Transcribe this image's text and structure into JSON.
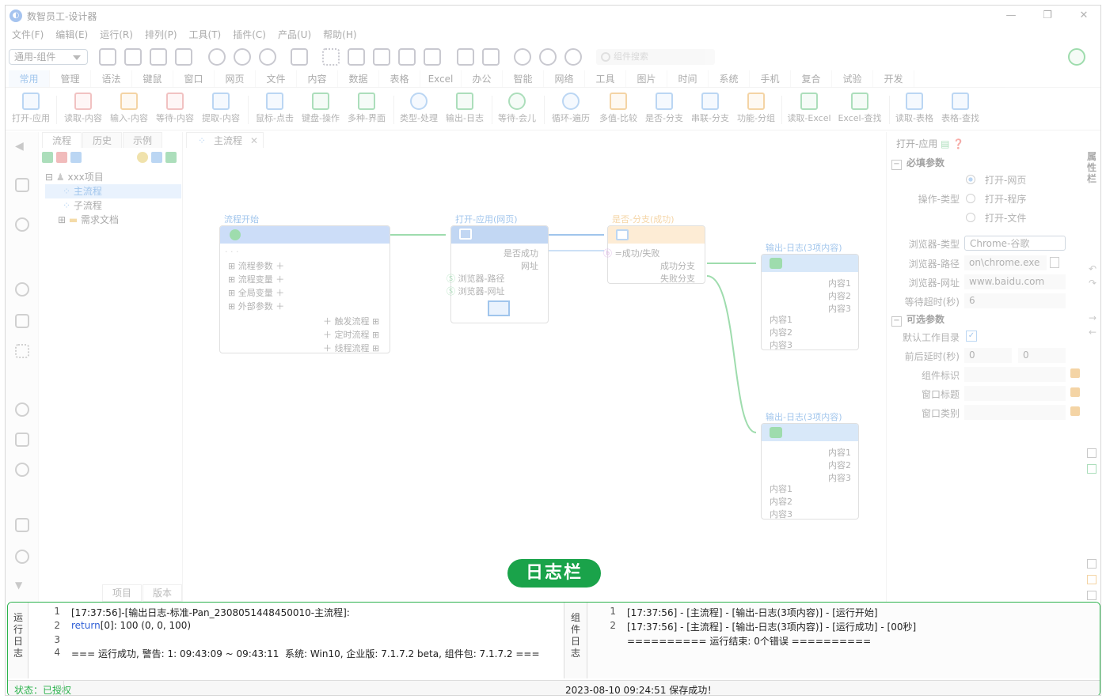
{
  "window": {
    "title": "数智员工-设计器",
    "minimize": "—",
    "maximize": "❐",
    "close": "✕"
  },
  "menu": [
    "文件(F)",
    "编辑(E)",
    "运行(R)",
    "排列(P)",
    "工具(T)",
    "插件(C)",
    "产品(U)",
    "帮助(H)"
  ],
  "toolbar": {
    "combo_value": "通用-组件",
    "search_placeholder": "组件搜索"
  },
  "category_tabs": [
    "常用",
    "管理",
    "语法",
    "键鼠",
    "窗口",
    "网页",
    "文件",
    "内容",
    "数据",
    "表格",
    "Excel",
    "办公",
    "智能",
    "网络",
    "工具",
    "图片",
    "时间",
    "系统",
    "手机",
    "复合",
    "试验",
    "开发"
  ],
  "ribbon": [
    "打开-应用",
    "读取-内容",
    "输入-内容",
    "等待-内容",
    "提取-内容",
    "鼠标-点击",
    "键盘-操作",
    "多种-界面",
    "类型-处理",
    "输出-日志",
    "等待-会儿",
    "循环-遍历",
    "多值-比较",
    "是否-分支",
    "串联-分支",
    "功能-分组",
    "读取-Excel",
    "Excel-查找",
    "读取-表格",
    "表格-查找"
  ],
  "left_panel": {
    "tabs": [
      "流程",
      "历史",
      "示例"
    ],
    "tree": {
      "root": "xxx项目",
      "items": [
        "主流程",
        "子流程",
        "需求文档"
      ]
    },
    "bottom_tabs": [
      "项目",
      "版本"
    ]
  },
  "canvas": {
    "doc_tab": "主流程",
    "doc_tab_close": "✕",
    "nodes": {
      "start": {
        "title": "流程开始",
        "rows": [
          "流程参数",
          "流程变量",
          "全局变量",
          "外部参数"
        ],
        "sub": [
          "触发流程",
          "定时流程",
          "线程流程"
        ],
        "dots": "· · ·"
      },
      "open_app": {
        "title": "打开-应用(网页)",
        "rows": [
          "是否成功",
          "网址"
        ],
        "inputs": [
          "浏览器-路径",
          "浏览器-网址"
        ]
      },
      "branch": {
        "title": "是否-分支(成功)",
        "cond": "=成功/失败",
        "outs": [
          "成功分支",
          "失败分支"
        ]
      },
      "log1": {
        "title": "输出-日志(3项内容)",
        "outs": [
          "内容1",
          "内容2",
          "内容3"
        ],
        "ins": [
          "内容1",
          "内容2",
          "内容3"
        ]
      },
      "log2": {
        "title": "输出-日志(3项内容)",
        "outs": [
          "内容1",
          "内容2",
          "内容3"
        ],
        "ins": [
          "内容1",
          "内容2",
          "内容3"
        ]
      }
    }
  },
  "right_panel": {
    "header": "打开-应用",
    "required": "必填参数",
    "op_type_label": "操作-类型",
    "op_options": [
      "打开-网页",
      "打开-程序",
      "打开-文件"
    ],
    "browser_type_label": "浏览器-类型",
    "browser_type_value": "Chrome-谷歌",
    "browser_path_label": "浏览器-路径",
    "browser_path_value": "on\\chrome.exe",
    "browser_url_label": "浏览器-网址",
    "browser_url_value": "www.baidu.com",
    "timeout_label": "等待超时(秒)",
    "timeout_value": "6",
    "optional": "可选参数",
    "default_dir_label": "默认工作目录",
    "delay_label": "前后延时(秒)",
    "delay_before": "0",
    "delay_after": "0",
    "comp_id_label": "组件标识",
    "win_title_label": "窗口标题",
    "win_class_label": "窗口类别",
    "side_text": "属性栏"
  },
  "overlay_label": "日志栏",
  "log": {
    "run_log_label": "运行日志",
    "comp_log_label": "组件日志",
    "left_lines": [
      {
        "n": "1",
        "t": "[17:37:56]-[输出日志-标准-Pan_2308051448450010-主流程]:"
      },
      {
        "n": "2",
        "kw": "return",
        "t": "[0]: 100 (0, 0, 100)"
      },
      {
        "n": "3",
        "t": ""
      },
      {
        "n": "4",
        "t": "=== 运行成功, 警告: 1: 09:43:09 ~ 09:43:11  系统: Win10, 企业版: 7.1.7.2 beta, 组件包: 7.1.7.2 ==="
      }
    ],
    "right_lines": [
      {
        "n": "1",
        "t": "[17:37:56] - [主流程] - [输出-日志(3项内容)] - [运行开始]"
      },
      {
        "n": "2",
        "t": "[17:37:56] - [主流程] - [输出-日志(3项内容)] - [运行成功] - [00秒]"
      },
      {
        "n": "",
        "t": "========== 运行结束: 0个错误 =========="
      }
    ],
    "status_left": "状态：已授权",
    "status_center": "2023-08-10 09:24:51 保存成功！"
  }
}
